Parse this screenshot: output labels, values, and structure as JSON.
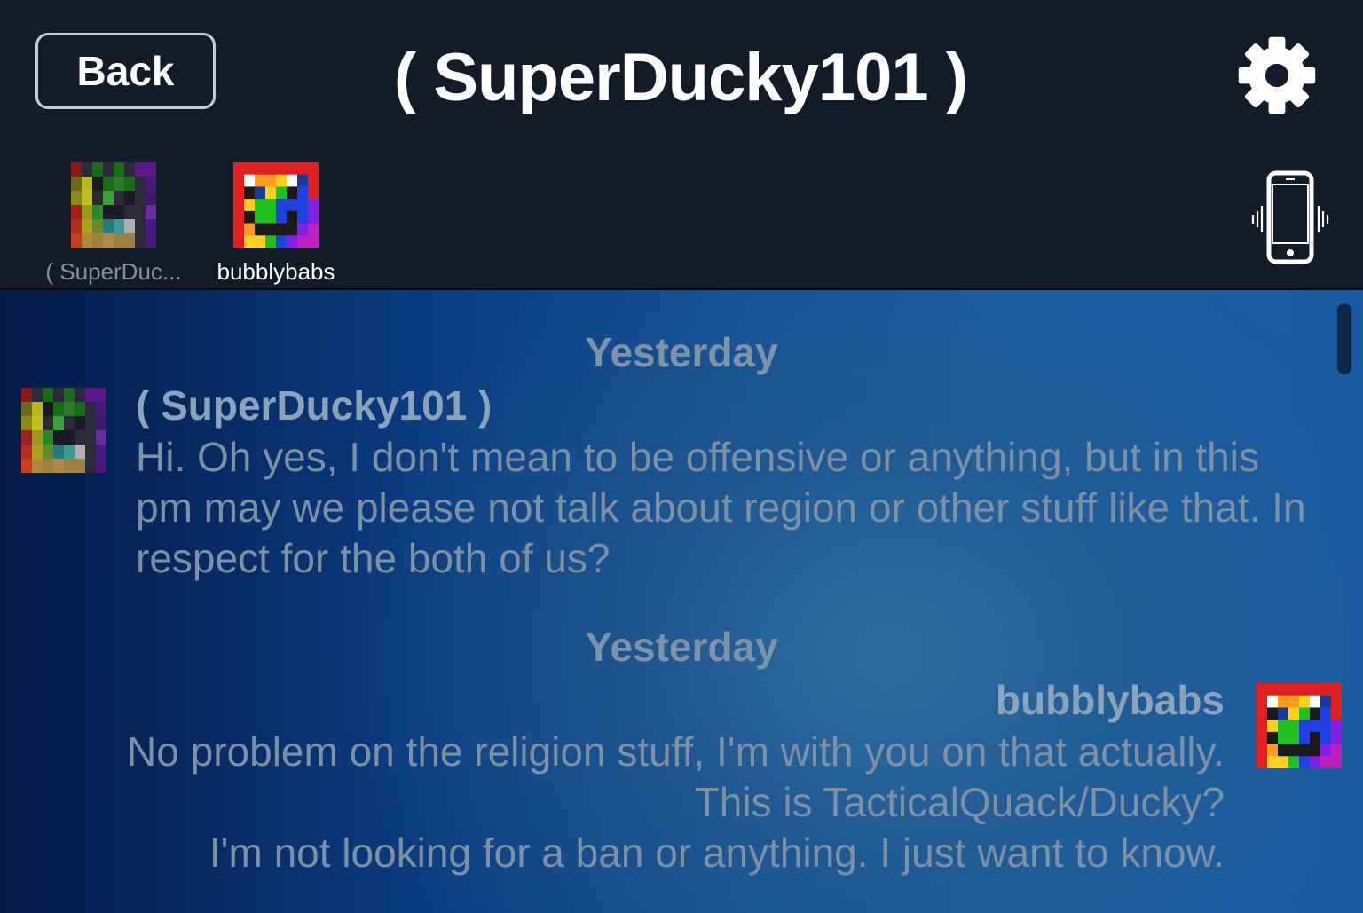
{
  "header": {
    "back_label": "Back",
    "title": "( SuperDucky101 )",
    "settings_icon": "gear-icon",
    "vibrate_icon": "phone-vibrate-icon"
  },
  "participants": [
    {
      "name": "( SuperDuc...",
      "avatar": "pixel-avatar-superducky"
    },
    {
      "name": "bubblybabs",
      "avatar": "pixel-avatar-bubblybabs"
    }
  ],
  "messages": [
    {
      "date": "Yesterday",
      "sender": "( SuperDucky101 )",
      "lines": [
        "Hi. Oh yes, I don't mean to be offensive or anything, but in this",
        "pm may we please not talk about region or other stuff like that. In",
        "respect for the both of us?"
      ]
    },
    {
      "date": "Yesterday",
      "sender": "bubblybabs",
      "lines": [
        "No problem on the religion stuff, I'm with you on that actually.",
        "This is TacticalQuack/Ducky?",
        "I'm not looking for a ban or anything.  I just want to know."
      ]
    }
  ],
  "colors": {
    "header_bg": "#121b27",
    "chat_bg_dark": "#031a45",
    "chat_bg_light": "#2f6d9f",
    "date_text": "#7d93aa",
    "message_text": "#7c90a6"
  },
  "avatars": {
    "superducky": [
      [
        "#8b1a1a",
        "#2a2a38",
        "#1a6a1a",
        "#2a2a38",
        "#1a6a1a",
        "#2a2a38",
        "#5a1a8a",
        "#5a1a8a"
      ],
      [
        "#6a6a1a",
        "#b8b820",
        "#1a1a1a",
        "#1a6a1a",
        "#2a7a2a",
        "#1a6a1a",
        "#2a2a38",
        "#4a1a7a"
      ],
      [
        "#8a8a1a",
        "#c0c020",
        "#2a2a2a",
        "#3aa03a",
        "#2a2a38",
        "#1a1a2a",
        "#2a2a38",
        "#3a1a6a"
      ],
      [
        "#a02020",
        "#9a9a20",
        "#2a8a2a",
        "#1a1a2a",
        "#1a1a2a",
        "#2a2a38",
        "#2a2a38",
        "#6a2aa0"
      ],
      [
        "#b03020",
        "#b0a020",
        "#6a8a2a",
        "#2a7a7a",
        "#3a9a9a",
        "#b0b0b0",
        "#2a2a38",
        "#4a1a8a"
      ],
      [
        "#c04020",
        "#b08a3a",
        "#a0803a",
        "#b08a4a",
        "#a08040",
        "#a08040",
        "#2a2a38",
        "#4a1a7a"
      ]
    ],
    "bubblybabs": [
      [
        "#e02020",
        "#e02020",
        "#e02020",
        "#e02020",
        "#e02020",
        "#e02020",
        "#e02020",
        "#e02020"
      ],
      [
        "#e02020",
        "#ffffff",
        "#ff9a20",
        "#ff9a20",
        "#ffd020",
        "#ffffff",
        "#1a3a9a",
        "#e02020"
      ],
      [
        "#e02020",
        "#1a1a1a",
        "#1a3a9a",
        "#ffd020",
        "#20c020",
        "#1a1a1a",
        "#2040e0",
        "#e02020"
      ],
      [
        "#e02020",
        "#ffd020",
        "#20c020",
        "#20c020",
        "#2040e0",
        "#2040e0",
        "#2040e0",
        "#8020e0"
      ],
      [
        "#e02020",
        "#1a1a1a",
        "#20c020",
        "#20c020",
        "#2040e0",
        "#1a1a1a",
        "#2040e0",
        "#8020e0"
      ],
      [
        "#e02020",
        "#ff9a20",
        "#1a1a1a",
        "#1a1a1a",
        "#1a1a1a",
        "#1a1a1a",
        "#8020e0",
        "#c020c0"
      ],
      [
        "#e02020",
        "#ffd020",
        "#ffd020",
        "#20c020",
        "#2040e0",
        "#8020e0",
        "#c020c0",
        "#c020c0"
      ]
    ]
  }
}
